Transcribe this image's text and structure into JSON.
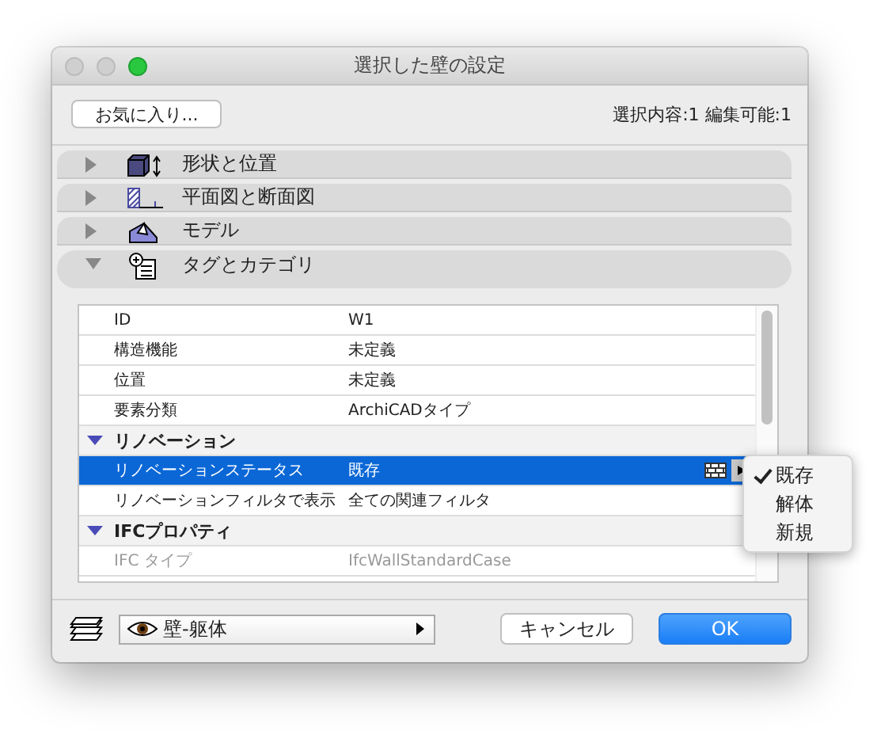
{
  "window": {
    "title": "選択した壁の設定"
  },
  "favorites_button": {
    "label": "お気に入り..."
  },
  "selection_info": "選択内容:1 編集可能:1",
  "sections": [
    {
      "label": "形状と位置",
      "kind": "shape",
      "expanded": false
    },
    {
      "label": "平面図と断面図",
      "kind": "plan",
      "expanded": false
    },
    {
      "label": "モデル",
      "kind": "model",
      "expanded": false
    },
    {
      "label": "タグとカテゴリ",
      "kind": "tags",
      "expanded": true
    }
  ],
  "properties": [
    {
      "kind": "row",
      "label": "ID",
      "value": "W1",
      "selected": false,
      "disabled": false
    },
    {
      "kind": "row",
      "label": "構造機能",
      "value": "未定義",
      "selected": false,
      "disabled": false
    },
    {
      "kind": "row",
      "label": "位置",
      "value": "未定義",
      "selected": false,
      "disabled": false
    },
    {
      "kind": "row",
      "label": "要素分類",
      "value": "ArchiCADタイプ",
      "selected": false,
      "disabled": false
    },
    {
      "kind": "group",
      "label": "リノベーション",
      "expanded": true
    },
    {
      "kind": "row",
      "label": "リノベーションステータス",
      "value": "既存",
      "selected": true,
      "disabled": false
    },
    {
      "kind": "row",
      "label": "リノベーションフィルタで表示",
      "value": "全ての関連フィルタ",
      "selected": false,
      "disabled": false
    },
    {
      "kind": "group",
      "label": "IFCプロパティ",
      "expanded": true
    },
    {
      "kind": "row",
      "label": "IFC タイプ",
      "value": "IfcWallStandardCase",
      "selected": false,
      "disabled": true
    }
  ],
  "status_menu": {
    "items": [
      {
        "label": "既存",
        "checked": true
      },
      {
        "label": "解体",
        "checked": false
      },
      {
        "label": "新規",
        "checked": false
      }
    ]
  },
  "layer_field": {
    "value": "壁-躯体"
  },
  "buttons": [
    {
      "label": "キャンセル",
      "kind": "normal"
    },
    {
      "label": "OK",
      "kind": "default"
    }
  ]
}
